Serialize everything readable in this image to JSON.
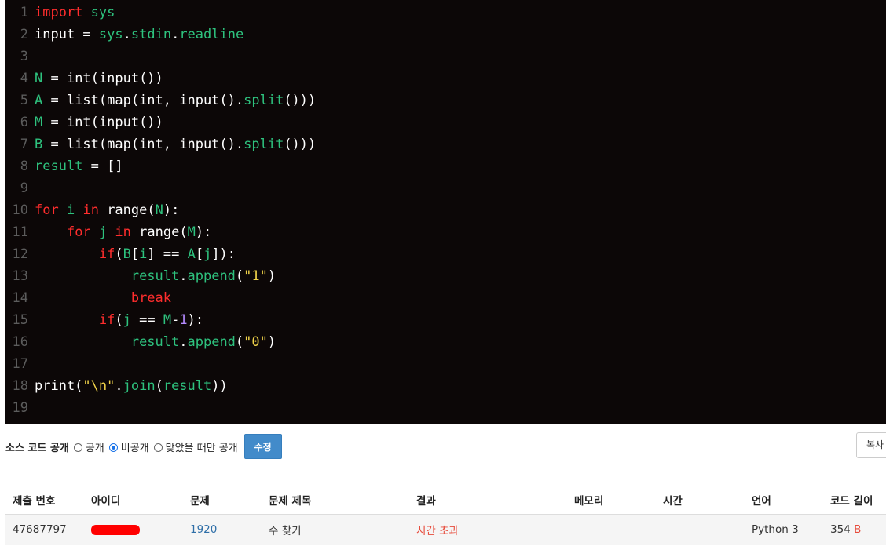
{
  "code": {
    "lines": [
      {
        "n": "1",
        "tokens": [
          {
            "t": "import",
            "c": "kw"
          },
          {
            "t": " sys",
            "c": "id"
          }
        ]
      },
      {
        "n": "2",
        "tokens": [
          {
            "t": "input",
            "c": "plain"
          },
          {
            "t": " = ",
            "c": "plain"
          },
          {
            "t": "sys",
            "c": "id"
          },
          {
            "t": ".",
            "c": "plain"
          },
          {
            "t": "stdin",
            "c": "id"
          },
          {
            "t": ".",
            "c": "plain"
          },
          {
            "t": "readline",
            "c": "id"
          }
        ]
      },
      {
        "n": "3",
        "tokens": []
      },
      {
        "n": "4",
        "tokens": [
          {
            "t": "N",
            "c": "var"
          },
          {
            "t": " = int(input())",
            "c": "plain"
          }
        ]
      },
      {
        "n": "5",
        "tokens": [
          {
            "t": "A",
            "c": "var"
          },
          {
            "t": " = list(map(int, input().",
            "c": "plain"
          },
          {
            "t": "split",
            "c": "attr"
          },
          {
            "t": "()))",
            "c": "plain"
          }
        ]
      },
      {
        "n": "6",
        "tokens": [
          {
            "t": "M",
            "c": "var"
          },
          {
            "t": " = int(input())",
            "c": "plain"
          }
        ]
      },
      {
        "n": "7",
        "tokens": [
          {
            "t": "B",
            "c": "var"
          },
          {
            "t": " = list(map(int, input().",
            "c": "plain"
          },
          {
            "t": "split",
            "c": "attr"
          },
          {
            "t": "()))",
            "c": "plain"
          }
        ]
      },
      {
        "n": "8",
        "tokens": [
          {
            "t": "result",
            "c": "var"
          },
          {
            "t": " = []",
            "c": "plain"
          }
        ]
      },
      {
        "n": "9",
        "tokens": []
      },
      {
        "n": "10",
        "tokens": [
          {
            "t": "for",
            "c": "kw"
          },
          {
            "t": " ",
            "c": "plain"
          },
          {
            "t": "i",
            "c": "var"
          },
          {
            "t": " ",
            "c": "plain"
          },
          {
            "t": "in",
            "c": "kw"
          },
          {
            "t": " range(",
            "c": "plain"
          },
          {
            "t": "N",
            "c": "var"
          },
          {
            "t": "):",
            "c": "plain"
          }
        ]
      },
      {
        "n": "11",
        "tokens": [
          {
            "t": "    ",
            "c": "plain"
          },
          {
            "t": "for",
            "c": "kw"
          },
          {
            "t": " ",
            "c": "plain"
          },
          {
            "t": "j",
            "c": "var"
          },
          {
            "t": " ",
            "c": "plain"
          },
          {
            "t": "in",
            "c": "kw"
          },
          {
            "t": " range(",
            "c": "plain"
          },
          {
            "t": "M",
            "c": "var"
          },
          {
            "t": "):",
            "c": "plain"
          }
        ]
      },
      {
        "n": "12",
        "tokens": [
          {
            "t": "        ",
            "c": "plain"
          },
          {
            "t": "if",
            "c": "kw"
          },
          {
            "t": "(",
            "c": "plain"
          },
          {
            "t": "B",
            "c": "var"
          },
          {
            "t": "[",
            "c": "plain"
          },
          {
            "t": "i",
            "c": "var"
          },
          {
            "t": "] == ",
            "c": "plain"
          },
          {
            "t": "A",
            "c": "var"
          },
          {
            "t": "[",
            "c": "plain"
          },
          {
            "t": "j",
            "c": "var"
          },
          {
            "t": "]):",
            "c": "plain"
          }
        ]
      },
      {
        "n": "13",
        "tokens": [
          {
            "t": "            ",
            "c": "plain"
          },
          {
            "t": "result",
            "c": "var"
          },
          {
            "t": ".",
            "c": "plain"
          },
          {
            "t": "append",
            "c": "attr"
          },
          {
            "t": "(",
            "c": "plain"
          },
          {
            "t": "\"1\"",
            "c": "str"
          },
          {
            "t": ")",
            "c": "plain"
          }
        ]
      },
      {
        "n": "14",
        "tokens": [
          {
            "t": "            ",
            "c": "plain"
          },
          {
            "t": "break",
            "c": "kw"
          }
        ]
      },
      {
        "n": "15",
        "tokens": [
          {
            "t": "        ",
            "c": "plain"
          },
          {
            "t": "if",
            "c": "kw"
          },
          {
            "t": "(",
            "c": "plain"
          },
          {
            "t": "j",
            "c": "var"
          },
          {
            "t": " == ",
            "c": "plain"
          },
          {
            "t": "M",
            "c": "var"
          },
          {
            "t": "-",
            "c": "plain"
          },
          {
            "t": "1",
            "c": "num"
          },
          {
            "t": "):",
            "c": "plain"
          }
        ]
      },
      {
        "n": "16",
        "tokens": [
          {
            "t": "            ",
            "c": "plain"
          },
          {
            "t": "result",
            "c": "var"
          },
          {
            "t": ".",
            "c": "plain"
          },
          {
            "t": "append",
            "c": "attr"
          },
          {
            "t": "(",
            "c": "plain"
          },
          {
            "t": "\"0\"",
            "c": "str"
          },
          {
            "t": ")",
            "c": "plain"
          }
        ]
      },
      {
        "n": "17",
        "tokens": []
      },
      {
        "n": "18",
        "tokens": [
          {
            "t": "print(",
            "c": "plain"
          },
          {
            "t": "\"\\n\"",
            "c": "str"
          },
          {
            "t": ".",
            "c": "plain"
          },
          {
            "t": "join",
            "c": "attr"
          },
          {
            "t": "(",
            "c": "plain"
          },
          {
            "t": "result",
            "c": "var"
          },
          {
            "t": "))",
            "c": "plain"
          }
        ]
      },
      {
        "n": "19",
        "tokens": []
      }
    ]
  },
  "controls": {
    "label": "소스 코드 공개",
    "options": [
      "공개",
      "비공개",
      "맞았을 때만 공개"
    ],
    "selected_index": 1,
    "edit_label": "수정",
    "copy_label": "복사"
  },
  "table": {
    "headers": [
      "제출 번호",
      "아이디",
      "문제",
      "문제 제목",
      "결과",
      "메모리",
      "시간",
      "언어",
      "코드 길이"
    ],
    "row": {
      "submission_id": "47687797",
      "problem": "1920",
      "title": "수 찾기",
      "result": "시간 초과",
      "memory": "",
      "time": "",
      "language": "Python 3",
      "code_length": "354",
      "code_length_unit": "B"
    }
  },
  "colors": {
    "editor_bg": "#0c0707",
    "keyword": "#ff2d2d",
    "identifier": "#2ec27e",
    "string": "#f2d44a",
    "number": "#b58bff",
    "result_error": "#e74c3c",
    "link": "#2f6fa8",
    "button": "#428bca"
  }
}
